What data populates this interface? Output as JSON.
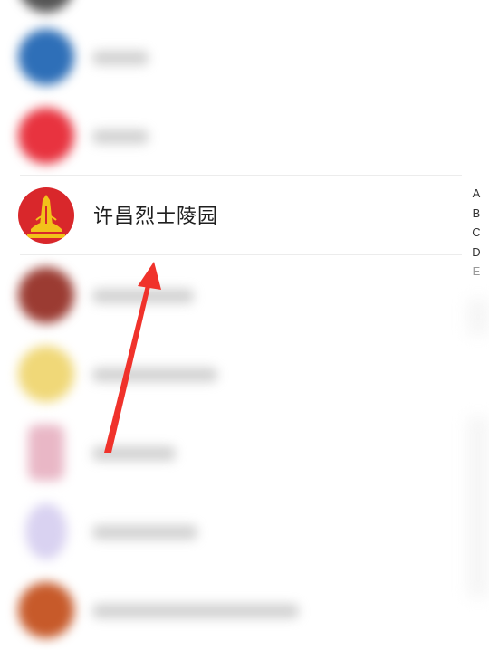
{
  "contact_list": {
    "focused_contact": {
      "name": "许昌烈士陵园",
      "avatar_color": "#d9272b",
      "avatar_emblem_color": "#f2c21a"
    },
    "blurred_rows": [
      {
        "avatar_color": "#2e6fb8"
      },
      {
        "avatar_color": "#e8333f"
      },
      {
        "avatar_color": "#9b3b32"
      },
      {
        "avatar_color": "#f0d878"
      },
      {
        "avatar_color": "#e9b7c6"
      },
      {
        "avatar_color": "#d9d2f1"
      },
      {
        "avatar_color": "#c75a2a"
      }
    ]
  },
  "index_bar": {
    "letters": [
      "A",
      "B",
      "C",
      "D",
      "E"
    ]
  },
  "annotation": {
    "arrow_color": "#f0322b"
  }
}
